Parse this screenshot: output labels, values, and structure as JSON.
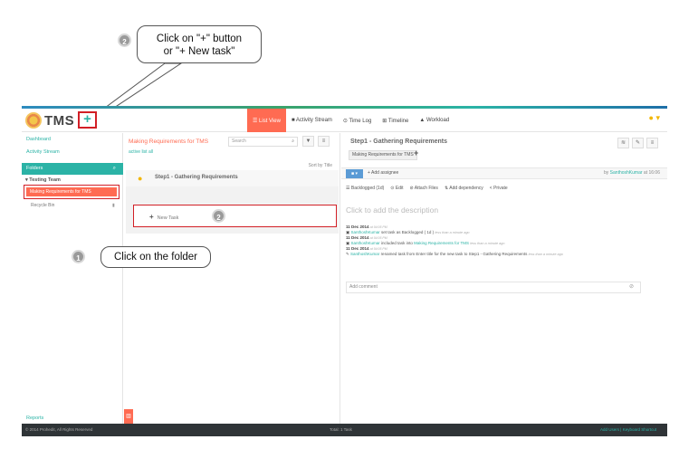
{
  "callouts": {
    "top": {
      "step": "2",
      "line1": "Click on \"+\" button",
      "line2": "or \"+ New task\""
    },
    "bottom": {
      "step": "1",
      "text": "Click on the folder"
    },
    "inline_step": "2"
  },
  "header": {
    "logo_text": "TMS",
    "add_label": "+",
    "nav": [
      {
        "label": "☰ List View",
        "active": true
      },
      {
        "label": "■ Activity Stream",
        "active": false
      },
      {
        "label": "⊙ Time Log",
        "active": false
      },
      {
        "label": "⊞ Timeline",
        "active": false
      },
      {
        "label": "▲ Workload",
        "active": false
      }
    ]
  },
  "sidebar": {
    "dashboard": "Dashboard",
    "activity_stream": "Activity Stream",
    "folders_label": "Folders",
    "team": "▾ Testing Team",
    "active_folder": "Making Requirements for TMS",
    "recycle": "Recycle Bin",
    "reports": "Reports"
  },
  "list": {
    "title": "Making Requirements for TMS",
    "search_placeholder": "Search",
    "filters": "active   list all",
    "sort": "Sort by Title",
    "task_name": "Step1 - Gathering Requirements",
    "new_task_label": "New Task"
  },
  "detail": {
    "title": "Step1 - Gathering Requirements",
    "crumb": "Making Requirements for TMS",
    "add_assignee": "+ Add assignee",
    "added_by_prefix": "by",
    "added_by_user": "SanthoshKumar",
    "added_by_suffix": "at 16:06",
    "meta": [
      "☰ Backlogged (1d)",
      "⊙ Edit",
      "⊘ Attach Files",
      "⇅ Add dependency",
      "< Private"
    ],
    "description_placeholder": "Click to add the description",
    "activity": [
      {
        "date": "11 Dec 2014",
        "time": "at 04:05 PM",
        "user": "SanthoshKumar",
        "text": " set task as Backlogged ( 1d )",
        "link": "",
        "ago": "less than a minute ago"
      },
      {
        "date": "11 Dec 2014",
        "time": "at 04:05 PM",
        "user": "SanthoshKumar",
        "text": " included task into ",
        "link": "Making Requirements for TMS",
        "ago": "less than a minute ago"
      },
      {
        "date": "11 Dec 2014",
        "time": "at 04:05 PM",
        "user": "SanthoshKumar",
        "text": " renamed task from Enter title for the new task to Step1 - Gathering Requirements",
        "link": "",
        "ago": "less than a minute ago"
      }
    ],
    "comment_placeholder": "Add comment"
  },
  "footer": {
    "copyright": "© 2014 Prohedit, All Rights Reserved",
    "total": "Total: 1 Task",
    "links": "Add Users  |  Keyboard Shortcut"
  }
}
